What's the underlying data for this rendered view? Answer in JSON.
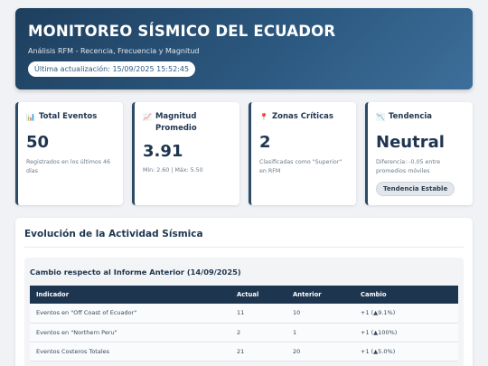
{
  "header": {
    "title": "MONITOREO SÍSMICO DEL ECUADOR",
    "subtitle": "Análisis RFM - Recencia, Frecuencia y Magnitud",
    "updated": "Última actualización: 15/09/2025 15:52:45"
  },
  "cards": [
    {
      "icon": "chart-icon",
      "icon_glyph": "📊",
      "title": "Total Eventos",
      "value": "50",
      "note": "Registrados en los últimos 46 días"
    },
    {
      "icon": "trending-up-icon",
      "icon_glyph": "📈",
      "title": "Magnitud Promedio",
      "value": "3.91",
      "note": "Mín: 2.60 | Máx: 5.50"
    },
    {
      "icon": "pin-icon",
      "icon_glyph": "📍",
      "title": "Zonas Críticas",
      "value": "2",
      "note": "Clasificadas como \"Superior\" en RFM"
    },
    {
      "icon": "trending-down-icon",
      "icon_glyph": "📉",
      "title": "Tendencia",
      "value": "Neutral",
      "note": "Diferencia: -0.05 entre promedios móviles",
      "badge": "Tendencia Estable"
    }
  ],
  "evolution": {
    "title": "Evolución de la Actividad Sísmica",
    "subtitle": "Cambio respecto al Informe Anterior (14/09/2025)",
    "columns": [
      "Indicador",
      "Actual",
      "Anterior",
      "Cambio"
    ],
    "rows": [
      [
        "Eventos en \"Off Coast of Ecuador\"",
        "11",
        "10",
        "+1 (▲9.1%)"
      ],
      [
        "Eventos en \"Northern Peru\"",
        "2",
        "1",
        "+1 (▲100%)"
      ],
      [
        "Eventos Costeros Totales",
        "21",
        "20",
        "+1 (▲5.0%)"
      ]
    ]
  }
}
